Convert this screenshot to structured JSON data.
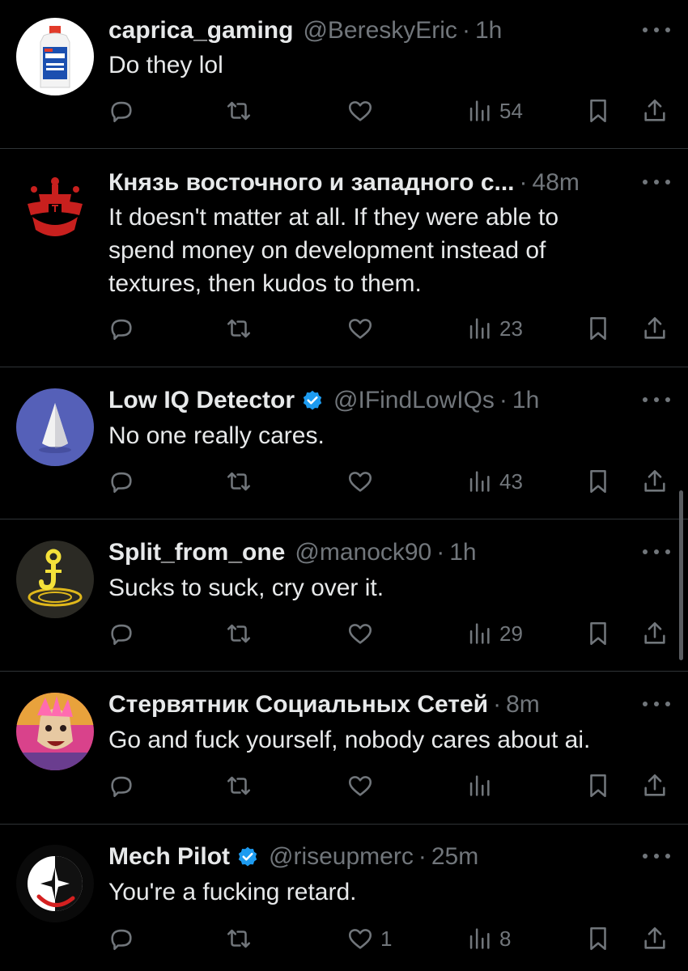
{
  "tweets": [
    {
      "name": "caprica_gaming",
      "verified": false,
      "handle": "@BereskyEric",
      "time": "1h",
      "text": "Do they lol",
      "reply_count": "",
      "retweet_count": "",
      "like_count": "",
      "views": "54",
      "avatar": "lighter-fluid-bottle-avatar"
    },
    {
      "name": "Князь восточного и западного с...",
      "verified": false,
      "handle": "",
      "time": "48m",
      "text": "It doesn't matter at all. If they were able to\nspend money on development instead of\ntextures, then kudos to them.",
      "reply_count": "",
      "retweet_count": "",
      "like_count": "",
      "views": "23",
      "avatar": "red-crest-avatar"
    },
    {
      "name": "Low IQ Detector",
      "verified": true,
      "handle": "@IFindLowIQs",
      "time": "1h",
      "text": "No one really cares.",
      "reply_count": "",
      "retweet_count": "",
      "like_count": "",
      "views": "43",
      "avatar": "white-cone-avatar"
    },
    {
      "name": "Split_from_one",
      "verified": false,
      "handle": "@manock90",
      "time": "1h",
      "text": "Sucks to suck, cry over it.",
      "reply_count": "",
      "retweet_count": "",
      "like_count": "",
      "views": "29",
      "avatar": "yellow-hook-avatar"
    },
    {
      "name": "Стервятник Социальных Сетей",
      "verified": false,
      "handle": "",
      "time": "8m",
      "text": "Go and fuck yourself, nobody cares about ai.",
      "reply_count": "",
      "retweet_count": "",
      "like_count": "",
      "views": "",
      "avatar": "punk-character-avatar"
    },
    {
      "name": "Mech Pilot",
      "verified": true,
      "handle": "@riseupmerc",
      "time": "25m",
      "text": "You're a fucking retard.",
      "reply_count": "",
      "retweet_count": "",
      "like_count": "1",
      "views": "8",
      "avatar": "star-emblem-avatar"
    }
  ],
  "colors": {
    "background": "#000000",
    "text": "#e7e9ea",
    "muted": "#71767b",
    "divider": "#2f3336",
    "verified": "#1d9bf0"
  }
}
